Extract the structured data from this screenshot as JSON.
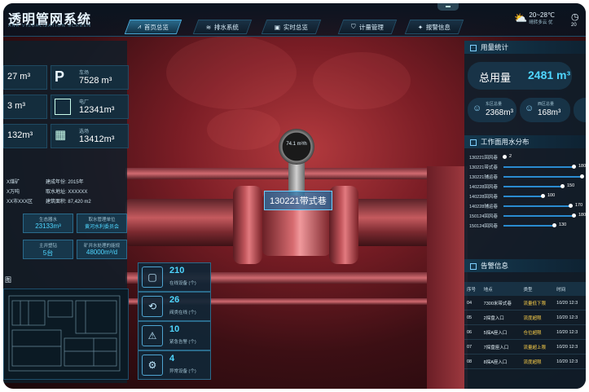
{
  "header": {
    "title": "透明管网系统",
    "subtitle": "ANK VISUALIZATION SCREEN",
    "nav": [
      "首页总览",
      "排水系统",
      "实时总览",
      "计量管理",
      "报警信息"
    ],
    "weather_temp": "20~28℃",
    "weather_desc": "晴转多云 优",
    "clock_text": "20"
  },
  "scene": {
    "gauge_reading": "74.1 m³/h",
    "pipe_tag": "130221带式巷"
  },
  "left": {
    "stats": [
      {
        "value": "27 m³"
      },
      {
        "label": "车场",
        "value": "7528 m³",
        "icon": "parking-icon"
      },
      {
        "value": "3 m³"
      },
      {
        "label": "电厂",
        "value": "12341m³",
        "icon": "factory-icon"
      },
      {
        "value": "132m³"
      },
      {
        "label": "选场",
        "value": "13412m³",
        "icon": "plant-icon"
      }
    ],
    "info": [
      {
        "k": "X煤矿",
        "v": "建成年份: 2015年"
      },
      {
        "k": "X万吨",
        "v": "取水地址: XXXXXX"
      },
      {
        "k": "XX市XXX区",
        "v": "建筑面积: 87,420 m2"
      }
    ],
    "chips": [
      {
        "t": "生态器水",
        "v": "23133m³"
      },
      {
        "t": "取水管理单位",
        "v": "黄河水利委员会"
      },
      {
        "t": "主井塑钻",
        "v": "5台"
      },
      {
        "t": "矿井水处理的能规",
        "v": "48000m³/d"
      }
    ],
    "floor_heading": "图"
  },
  "mid_cards": [
    {
      "num": "210",
      "label": "在线设备 (个)",
      "icon": "monitor-icon"
    },
    {
      "num": "26",
      "label": "阀类在线 (个)",
      "icon": "valve-icon"
    },
    {
      "num": "10",
      "label": "紧急告警 (个)",
      "icon": "alarm-icon"
    },
    {
      "num": "4",
      "label": "异常设备 (个)",
      "icon": "gear-warning-icon"
    }
  ],
  "right": {
    "usage_title": "用量统计",
    "total_label": "总用量",
    "total_value": "2481 m³",
    "zones": [
      {
        "label": "东区总量",
        "value": "2368m³"
      },
      {
        "label": "西区总量",
        "value": "168m³"
      }
    ],
    "dist_title": "工作面用水分布",
    "dist": [
      {
        "name": "130221回风巷",
        "value": "2"
      },
      {
        "name": "130221带式巷",
        "value": "180"
      },
      {
        "name": "130221辅运巷",
        "value": "200"
      },
      {
        "name": "140228回风巷",
        "value": "150"
      },
      {
        "name": "140228回风巷",
        "value": "100"
      },
      {
        "name": "140228辅运巷",
        "value": "170"
      },
      {
        "name": "150124回风巷",
        "value": "180"
      },
      {
        "name": "150124回风巷",
        "value": "130"
      }
    ],
    "alarm_title": "告警信息",
    "alarm_cols": [
      "序号",
      "地点",
      "类型",
      "时间"
    ],
    "alarms": [
      {
        "no": "04",
        "place": "7300米带式巷",
        "type": "流量低下限",
        "time": "10/20 12:3"
      },
      {
        "no": "05",
        "place": "2探盘入口",
        "type": "流度超限",
        "time": "10/20 12:3"
      },
      {
        "no": "06",
        "place": "5探A座入口",
        "type": "仓位超限",
        "time": "10/20 12:3"
      },
      {
        "no": "07",
        "place": "7探盘座入口",
        "type": "流量超上限",
        "time": "10/20 12:3"
      },
      {
        "no": "08",
        "place": "8探A座入口",
        "type": "流度超限",
        "time": "10/20 12:3"
      }
    ]
  }
}
